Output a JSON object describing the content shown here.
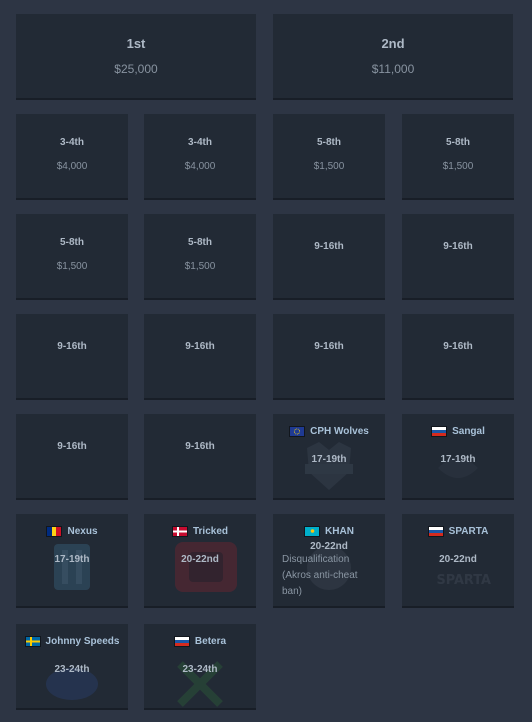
{
  "top": [
    {
      "place": "1st",
      "prize": "$25,000"
    },
    {
      "place": "2nd",
      "prize": "$11,000"
    }
  ],
  "rows": {
    "r1": [
      {
        "place": "3-4th",
        "prize": "$4,000"
      },
      {
        "place": "3-4th",
        "prize": "$4,000"
      },
      {
        "place": "5-8th",
        "prize": "$1,500"
      },
      {
        "place": "5-8th",
        "prize": "$1,500"
      }
    ],
    "r2": [
      {
        "place": "5-8th",
        "prize": "$1,500"
      },
      {
        "place": "5-8th",
        "prize": "$1,500"
      },
      {
        "place": "9-16th"
      },
      {
        "place": "9-16th"
      }
    ],
    "r3": [
      {
        "place": "9-16th"
      },
      {
        "place": "9-16th"
      },
      {
        "place": "9-16th"
      },
      {
        "place": "9-16th"
      }
    ],
    "r4": [
      {
        "place": "9-16th"
      },
      {
        "place": "9-16th"
      },
      {
        "team": "CPH Wolves",
        "place": "17-19th",
        "flag": "eu-flag"
      },
      {
        "team": "Sangal",
        "place": "17-19th",
        "flag": "russia-flag"
      }
    ],
    "r5": [
      {
        "team": "Nexus",
        "place": "17-19th",
        "flag": "romania-flag"
      },
      {
        "team": "Tricked",
        "place": "20-22nd",
        "flag": "denmark-flag"
      },
      {
        "team": "KHAN",
        "place": "20-22nd",
        "flag": "kazakhstan-flag",
        "note": "Disqualification (Akros anti-cheat ban)"
      },
      {
        "team": "SPARTA",
        "place": "20-22nd",
        "flag": "russia-flag"
      }
    ],
    "r6": [
      {
        "team": "Johnny Speeds",
        "place": "23-24th",
        "flag": "sweden-flag"
      },
      {
        "team": "Betera",
        "place": "23-24th",
        "flag": "russia-flag"
      }
    ]
  },
  "colors": {
    "page_background": "#2d3544",
    "card_background": "#222a35",
    "place_text": "#aeb9c6",
    "prize_text": "#8893a0",
    "team_text": "#a9c2d9"
  }
}
